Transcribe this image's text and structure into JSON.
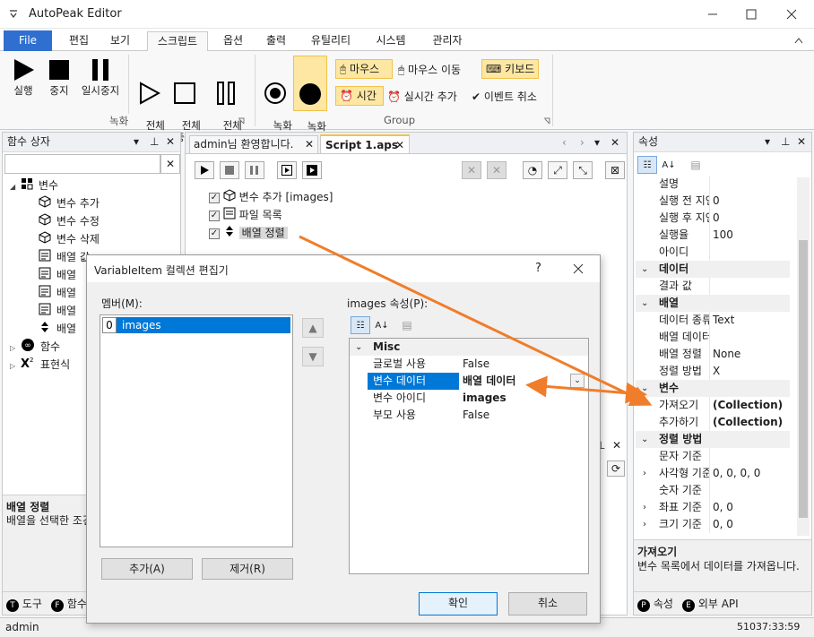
{
  "app": {
    "title": "AutoPeak Editor"
  },
  "menu": {
    "file": "File",
    "tabs": [
      "편집",
      "보기",
      "스크립트",
      "옵션",
      "출력",
      "유틸리티",
      "시스템",
      "관리자"
    ]
  },
  "ribbon": {
    "run": "실행",
    "stop": "중지",
    "pause": "일시중지",
    "run_all": "전체\n실행",
    "stop_all": "전체\n중지",
    "pause_all": "전체\n일시중지",
    "record_start": "녹화\n시작",
    "record_stop": "녹화\n중지",
    "group_record": "녹화",
    "group_group": "Group",
    "mouse": "마우스",
    "mouse_move": "마우스 이동",
    "keyboard": "키보드",
    "time": "시간",
    "realtime_add": "실시간 추가",
    "event_cancel": "이벤트 취소"
  },
  "function_box": {
    "title": "함수 상자",
    "search_value": "",
    "tree": [
      {
        "label": "변수",
        "level": 0,
        "icon": "variable-group-icon"
      },
      {
        "label": "변수 추가",
        "level": 1,
        "icon": "cube-icon"
      },
      {
        "label": "변수 수정",
        "level": 1,
        "icon": "cube-icon"
      },
      {
        "label": "변수 삭제",
        "level": 1,
        "icon": "cube-icon"
      },
      {
        "label": "배열 값",
        "level": 1,
        "icon": "array-icon"
      },
      {
        "label": "배열",
        "level": 1,
        "icon": "array-icon"
      },
      {
        "label": "배열",
        "level": 1,
        "icon": "array-icon"
      },
      {
        "label": "배열",
        "level": 1,
        "icon": "array-icon"
      },
      {
        "label": "배열",
        "level": 1,
        "icon": "sort-icon"
      },
      {
        "label": "함수",
        "level": 0,
        "icon": "infinity-icon"
      },
      {
        "label": "표현식",
        "level": 0,
        "icon": "x-squared-icon"
      }
    ],
    "info_title": "배열 정렬",
    "info_desc": "배열을 선택한 조건으로 정렬합니다.",
    "bottom_tabs": [
      "도구",
      "함수"
    ]
  },
  "editor": {
    "tabs": [
      "admin님 환영합니다.",
      "Script 1.aps"
    ],
    "lines": [
      {
        "label": "변수 추가 [images]",
        "checked": true
      },
      {
        "label": "파일 목록",
        "checked": true
      },
      {
        "label": "배열 정렬",
        "checked": true
      }
    ]
  },
  "properties": {
    "title": "속성",
    "rows": [
      {
        "type": "row",
        "name": "설명",
        "value": ""
      },
      {
        "type": "row",
        "name": "실행 전 지연",
        "value": "0"
      },
      {
        "type": "row",
        "name": "실행 후 지연",
        "value": "0"
      },
      {
        "type": "row",
        "name": "실행율",
        "value": "100"
      },
      {
        "type": "row",
        "name": "아이디",
        "value": ""
      },
      {
        "type": "cat",
        "name": "데이터"
      },
      {
        "type": "row",
        "name": "결과 값",
        "value": ""
      },
      {
        "type": "cat",
        "name": "배열"
      },
      {
        "type": "row",
        "name": "데이터 종류",
        "value": "Text"
      },
      {
        "type": "row",
        "name": "배열 데이터",
        "value": ""
      },
      {
        "type": "row",
        "name": "배열 정렬",
        "value": "None"
      },
      {
        "type": "row",
        "name": "정렬 방법",
        "value": "X"
      },
      {
        "type": "cat",
        "name": "변수"
      },
      {
        "type": "row",
        "name": "가져오기",
        "value": "(Collection)",
        "bold": true
      },
      {
        "type": "row",
        "name": "추가하기",
        "value": "(Collection)",
        "bold": true
      },
      {
        "type": "cat",
        "name": "정렬 방법"
      },
      {
        "type": "row",
        "name": "문자 기준",
        "value": ""
      },
      {
        "type": "row",
        "name": "사각형 기준",
        "value": "0, 0, 0, 0",
        "expand": true
      },
      {
        "type": "row",
        "name": "숫자 기준",
        "value": ""
      },
      {
        "type": "row",
        "name": "좌표 기준",
        "value": "0, 0",
        "expand": true
      },
      {
        "type": "row",
        "name": "크기 기준",
        "value": "0, 0",
        "expand": true
      }
    ],
    "info_title": "가져오기",
    "info_desc": "변수 목록에서 데이터를 가져옵니다.",
    "bottom_tabs": [
      "속성",
      "외부 API"
    ]
  },
  "dialog": {
    "title": "VariableItem 컬렉션 편집기",
    "help": "?",
    "members_label": "멤버(M):",
    "members": [
      {
        "index": "0",
        "name": "images"
      }
    ],
    "props_label": "images 속성(P):",
    "category": "Misc",
    "props": [
      {
        "name": "글로벌 사용",
        "value": "False"
      },
      {
        "name": "변수 데이터",
        "value": "배열 데이터",
        "selected": true
      },
      {
        "name": "변수 아이디",
        "value": "images",
        "bold": true
      },
      {
        "name": "부모 사용",
        "value": "False"
      }
    ],
    "add": "추가(A)",
    "remove": "제거(R)",
    "ok": "확인",
    "cancel": "취소"
  },
  "status": {
    "user": "admin",
    "time": "51037:33:59"
  },
  "colors": {
    "accent": "#2f6fd0",
    "highlight": "#fde7a3",
    "arrow": "#f07d2a",
    "selection": "#0078d7"
  }
}
